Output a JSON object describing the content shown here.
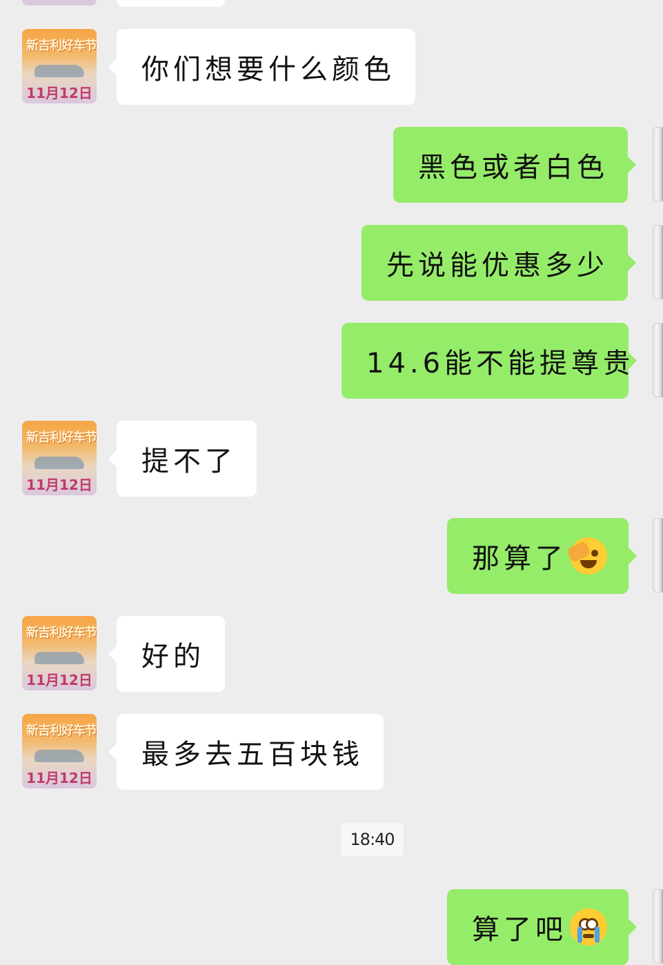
{
  "chat": {
    "contact_avatar_caption": "11月12日",
    "contact_avatar_art": "新吉利好车节",
    "time_separator": "18:40",
    "messages": [
      {
        "side": "left",
        "text": "你们想要什么颜色"
      },
      {
        "side": "right",
        "text": "黑色或者白色"
      },
      {
        "side": "right",
        "text": "先说能优惠多少"
      },
      {
        "side": "right",
        "text": "14.6能不能提尊贵"
      },
      {
        "side": "left",
        "text": "提不了"
      },
      {
        "side": "right",
        "text": "那算了",
        "emoji": "face-palm-laughing-emoji"
      },
      {
        "side": "left",
        "text": "好的"
      },
      {
        "side": "left",
        "text": "最多去五百块钱"
      },
      {
        "side": "right",
        "text": "算了吧",
        "emoji": "crying-face-emoji"
      }
    ]
  },
  "colors": {
    "background": "#ededed",
    "incoming_bubble": "#ffffff",
    "outgoing_bubble": "#95ec69"
  }
}
